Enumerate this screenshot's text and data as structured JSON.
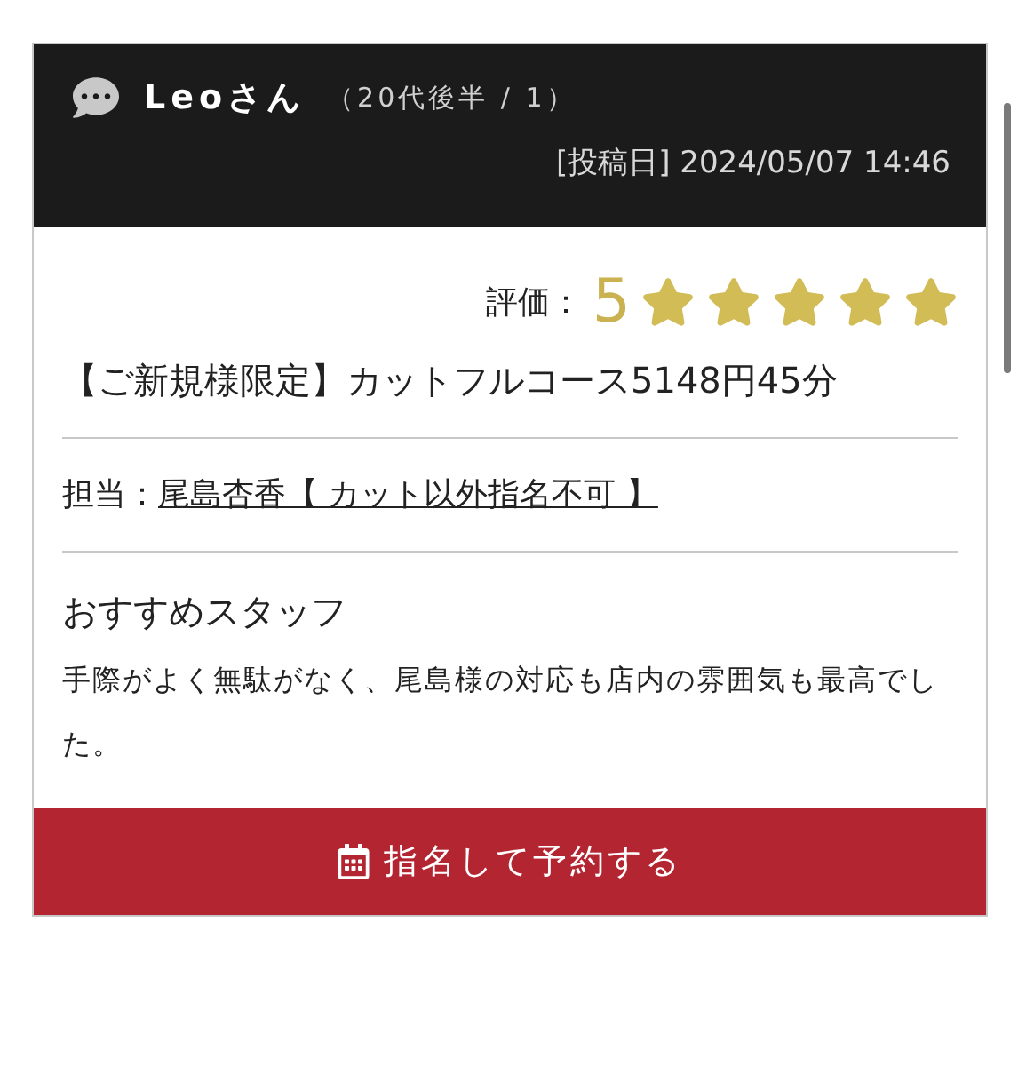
{
  "review": {
    "reviewer": "Leoさん",
    "reviewer_info": "（20代後半 / 1）",
    "posted": "[投稿日] 2024/05/07 14:46",
    "rating_label": "評価：",
    "rating_value": "5",
    "stars": 5,
    "course": "【ご新規様限定】カットフルコース5148円45分",
    "staff_label": "担当：",
    "staff_name": "尾島杏香【 カット以外指名不可 】",
    "heading": "おすすめスタッフ",
    "body": "手際がよく無駄がなく、尾島様の対応も店内の雰囲気も最高でした。",
    "button": "指名して予約する"
  }
}
